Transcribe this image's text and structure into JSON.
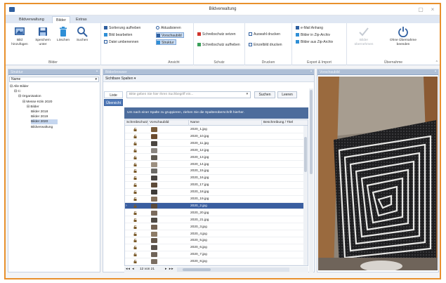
{
  "window": {
    "title": "Bildverwaltung",
    "minimize_glyph": "▢",
    "close_glyph": "×"
  },
  "tabs": [
    {
      "label": "Bildverwaltung",
      "active": false
    },
    {
      "label": "Bilder",
      "active": true
    },
    {
      "label": "Extras",
      "active": false
    }
  ],
  "ribbon": {
    "bilder": {
      "label": "Bilder",
      "add": {
        "line1": "Bild",
        "line2": "hinzufügen",
        "icon": "add-image-icon"
      },
      "save": {
        "line1": "Speichern",
        "line2": "unter",
        "icon": "save-icon"
      },
      "delete": {
        "label": "Löschen",
        "icon": "trash-icon"
      },
      "search": {
        "label": "Suchen",
        "icon": "search-icon"
      }
    },
    "sort_group": {
      "sort_off": "Sortierung aufheben",
      "edit": "Bild bearbeiten",
      "rename": "Datei umbenennen"
    },
    "ansicht": {
      "label": "Ansicht",
      "refresh": "Aktualisieren",
      "preview": "Vorschaubild",
      "structure": "Struktur"
    },
    "schutz": {
      "label": "Schutz",
      "set": "Schreibschutz setzen",
      "remove": "Schreibschutz aufheben"
    },
    "drucken": {
      "label": "Drucken",
      "print_selection": "Auswahl drucken",
      "print_single": "Einzelbild drucken"
    },
    "export": {
      "label": "Export & Import",
      "email": "e-Mail Anhang",
      "to_zip": "Bilder in Zip-Archiv",
      "from_zip": "Bilder aus Zip-Archiv"
    },
    "uebernahme": {
      "label": "Übernahme",
      "take_over": {
        "line1": "Bilder",
        "line2": "übernehmen"
      },
      "exit": {
        "line1": "Ohne Übernahme",
        "line2": "beenden"
      }
    }
  },
  "left_pane": {
    "title": "Struktur",
    "pin": "▪",
    "combo_value": "Name",
    "combo_arrow": "▾",
    "tree": [
      {
        "label": "⊟ Alle Bilder",
        "indent": 0,
        "selected": false
      },
      {
        "label": "⊟ C:",
        "indent": 1,
        "selected": false
      },
      {
        "label": "⊟ Organisation",
        "indent": 2,
        "selected": false
      },
      {
        "label": "⊟ Messe Köln 2020",
        "indent": 3,
        "selected": false
      },
      {
        "label": "⊟ Bilder",
        "indent": 4,
        "selected": false
      },
      {
        "label": "Bilder 2018",
        "indent": 5,
        "selected": false
      },
      {
        "label": "Bilder 2019",
        "indent": 5,
        "selected": false
      },
      {
        "label": "Bilder 2020",
        "indent": 5,
        "selected": true
      },
      {
        "label": "Bildverwaltung",
        "indent": 5,
        "selected": false
      }
    ]
  },
  "mid_pane": {
    "title": "Bilderbrowser",
    "pin": "▪",
    "visible_columns": "Sichtbare Spalten ▾",
    "view_tabs": [
      {
        "label": "Liste",
        "active": false
      },
      {
        "label": "Übersicht",
        "active": true
      }
    ],
    "search_placeholder": "Bitte geben Sie hier Ihren Suchbegriff ein...",
    "search_arrow": "▾",
    "search_button": "Suchen",
    "clear_button": "Leeren",
    "group_hint": "Um nach einer Spalte zu gruppieren, ziehen Sie die Spaltenüberschrift hierher.",
    "columns": [
      "Schreibschutz",
      "Vorschaubild",
      "Name",
      "Beschreibung / Titel"
    ],
    "rows": [
      {
        "name": "2020_1.jpg",
        "thumb": "#7a5c3a",
        "selected": false
      },
      {
        "name": "2020_10.jpg",
        "thumb": "#6b4b2e",
        "selected": false
      },
      {
        "name": "2020_11.jpg",
        "thumb": "#4a4540",
        "selected": false
      },
      {
        "name": "2020_12.jpg",
        "thumb": "#8a8580",
        "selected": false
      },
      {
        "name": "2020_13.jpg",
        "thumb": "#5f5a52",
        "selected": false
      },
      {
        "name": "2020_14.jpg",
        "thumb": "#9c8f80",
        "selected": false
      },
      {
        "name": "2020_15.jpg",
        "thumb": "#6c6a66",
        "selected": false
      },
      {
        "name": "2020_16.jpg",
        "thumb": "#474340",
        "selected": false
      },
      {
        "name": "2020_17.jpg",
        "thumb": "#5d4a38",
        "selected": false
      },
      {
        "name": "2020_18.jpg",
        "thumb": "#3e3b38",
        "selected": false
      },
      {
        "name": "2020_19.jpg",
        "thumb": "#85715c",
        "selected": false
      },
      {
        "name": "2020_2.jpg",
        "thumb": "#5a4a3c",
        "selected": true
      },
      {
        "name": "2020_20.jpg",
        "thumb": "#7b6b5c",
        "selected": false
      },
      {
        "name": "2020_21.jpg",
        "thumb": "#4f4a44",
        "selected": false
      },
      {
        "name": "2020_3.jpg",
        "thumb": "#736252",
        "selected": false
      },
      {
        "name": "2020_4.jpg",
        "thumb": "#8d7b66",
        "selected": false
      },
      {
        "name": "2020_5.jpg",
        "thumb": "#64574a",
        "selected": false
      },
      {
        "name": "2020_6.jpg",
        "thumb": "#57504a",
        "selected": false
      },
      {
        "name": "2020_7.jpg",
        "thumb": "#6e6358",
        "selected": false
      },
      {
        "name": "2020_8.jpg",
        "thumb": "#7a6e62",
        "selected": false
      }
    ],
    "pager_text": "12 von 21",
    "selected_indicator": "›"
  },
  "preview_pane": {
    "title": "Vorschaubild",
    "pin": "▪"
  },
  "colors": {
    "window_border": "#e8902c",
    "accent": "#3a5ea0",
    "pane_header": "#aebfd6"
  }
}
